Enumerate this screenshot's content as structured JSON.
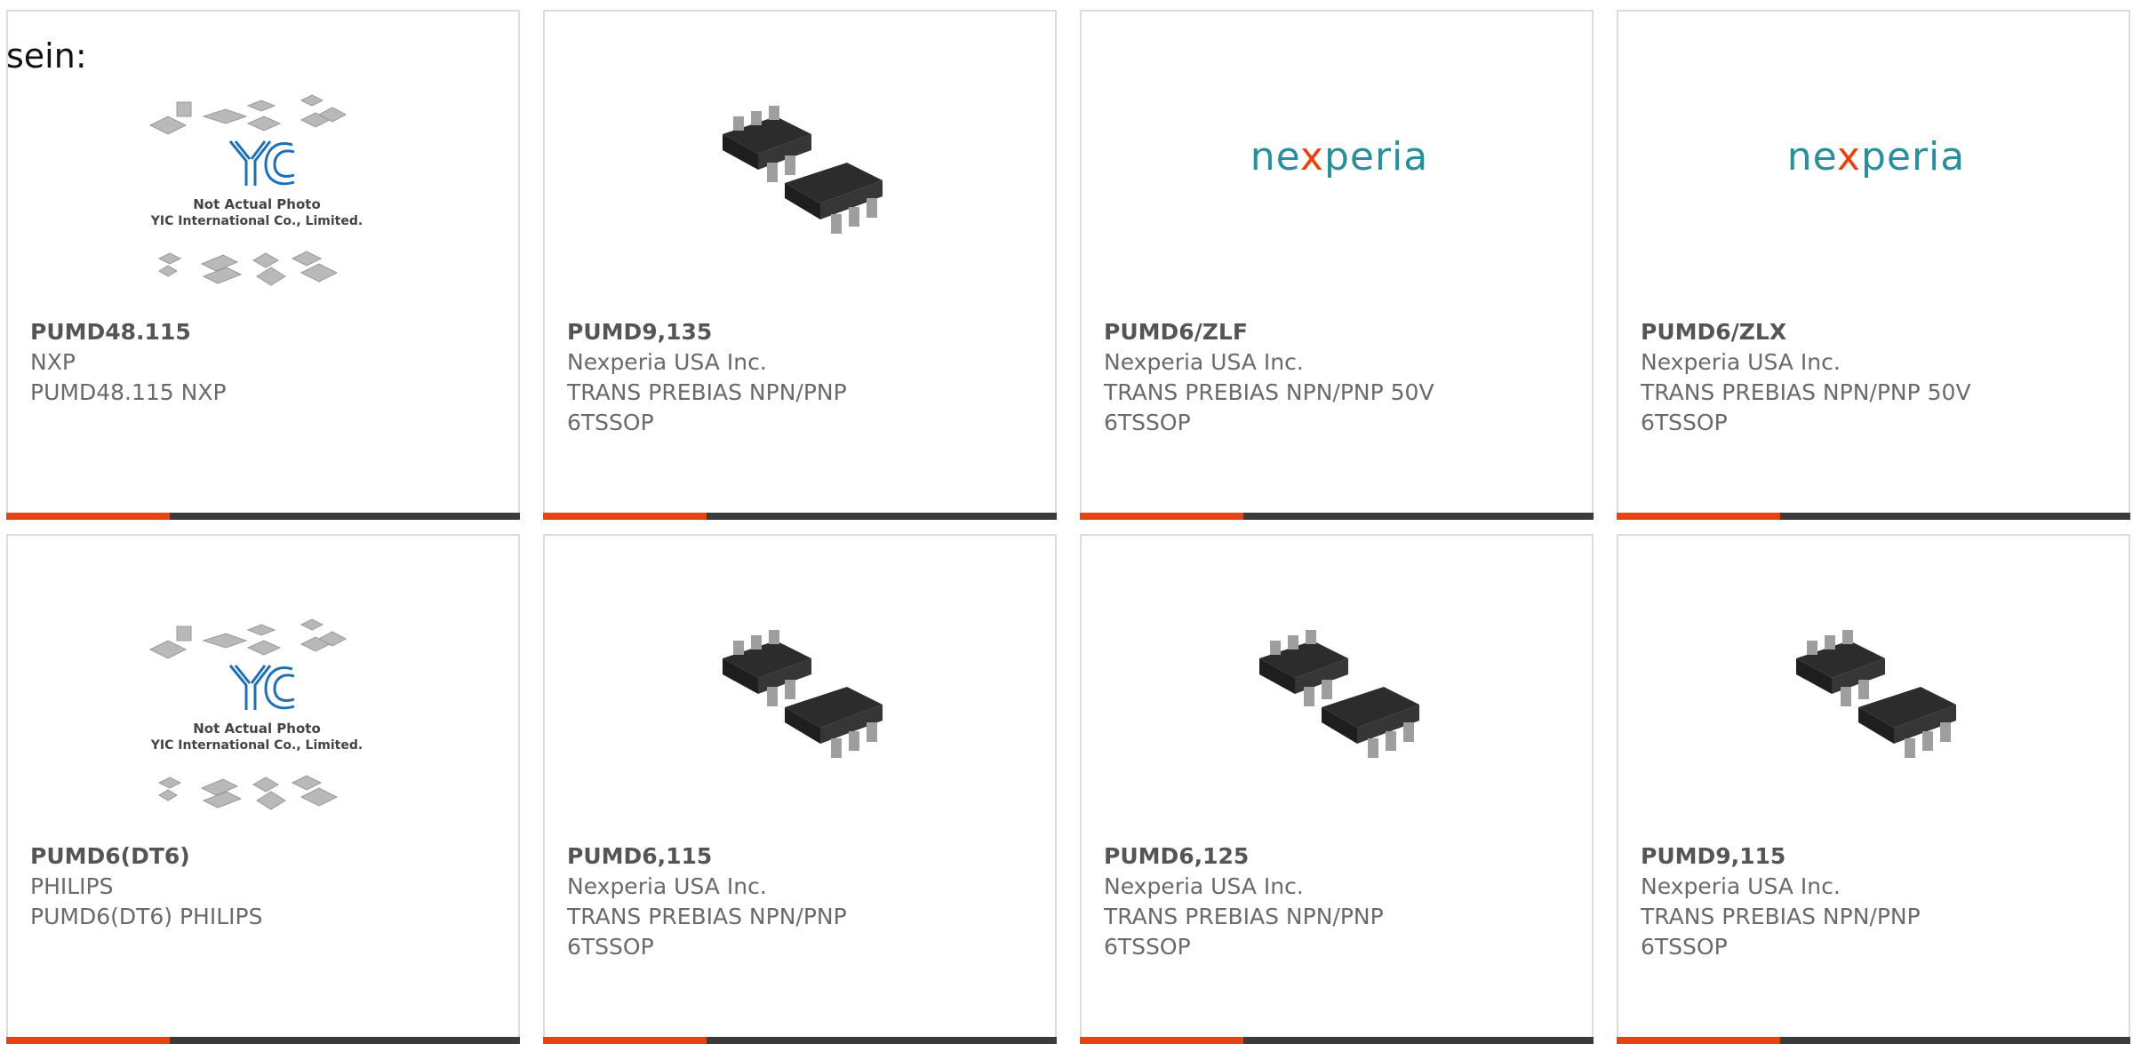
{
  "intro_text": "sein:",
  "cards": [
    {
      "part": "PUMD48.115",
      "lines": [
        "NXP",
        "PUMD48.115 NXP",
        ""
      ],
      "image": "yic-placeholder-photo"
    },
    {
      "part": "PUMD9,135",
      "lines": [
        "Nexperia USA Inc.",
        "TRANS PREBIAS NPN/PNP",
        "6TSSOP"
      ],
      "image": "sot363-package"
    },
    {
      "part": "PUMD6/ZLF",
      "lines": [
        "Nexperia USA Inc.",
        "TRANS PREBIAS NPN/PNP 50V",
        "6TSSOP"
      ],
      "image": "nexperia-logo"
    },
    {
      "part": "PUMD6/ZLX",
      "lines": [
        "Nexperia USA Inc.",
        "TRANS PREBIAS NPN/PNP 50V",
        "6TSSOP"
      ],
      "image": "nexperia-logo"
    },
    {
      "part": "PUMD6(DT6)",
      "lines": [
        "PHILIPS",
        "PUMD6(DT6) PHILIPS",
        ""
      ],
      "image": "yic-placeholder-photo"
    },
    {
      "part": "PUMD6,115",
      "lines": [
        "Nexperia USA Inc.",
        "TRANS PREBIAS NPN/PNP",
        "6TSSOP"
      ],
      "image": "sot363-package"
    },
    {
      "part": "PUMD6,125",
      "lines": [
        "Nexperia USA Inc.",
        "TRANS PREBIAS NPN/PNP",
        "6TSSOP"
      ],
      "image": "sot363-package"
    },
    {
      "part": "PUMD9,115",
      "lines": [
        "Nexperia USA Inc.",
        "TRANS PREBIAS NPN/PNP",
        "6TSSOP"
      ],
      "image": "sot363-package"
    }
  ],
  "yic": {
    "brand": "YIC",
    "caption_1": "Not Actual Photo",
    "caption_2": "YIC International Co., Limited."
  },
  "nexperia": {
    "pre": "ne",
    "x": "x",
    "post": "peria"
  },
  "colors": {
    "accent": "#e8430f",
    "bar": "#3b3b3b",
    "border": "#dcdcdc",
    "text": "#6a6a6a",
    "nexperia_teal": "#2a8f9b",
    "yic_blue": "#1f6fb3"
  }
}
